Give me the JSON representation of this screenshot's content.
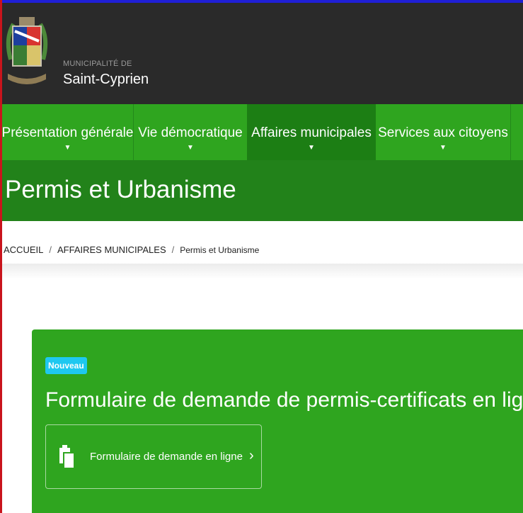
{
  "header": {
    "brand_sub": "MUNICIPALITÉ DE",
    "brand_name": "Saint-Cyprien"
  },
  "nav": {
    "items": [
      {
        "label": "Présentation générale",
        "caret": "▼"
      },
      {
        "label": "Vie démocratique",
        "caret": "▼"
      },
      {
        "label": "Affaires municipales",
        "caret": "▼"
      },
      {
        "label": "Services aux citoyens",
        "caret": "▼"
      }
    ]
  },
  "banner": {
    "title": "Permis et Urbanisme"
  },
  "breadcrumb": {
    "items": [
      "ACCUEIL",
      "AFFAIRES MUNICIPALES",
      "Permis et Urbanisme"
    ],
    "separator": "/"
  },
  "card": {
    "badge": "Nouveau",
    "title": "Formulaire de demande de permis-certificats en ligne",
    "link_label": "Formulaire de demande en ligne",
    "link_chevron": "›"
  },
  "colors": {
    "header_bg": "#2a2a2a",
    "nav_green": "#2fa51f",
    "nav_active": "#1c7e14",
    "banner_green": "#22821a",
    "badge_cyan": "#1ec8f0"
  },
  "icons": [
    "coat-of-arms-logo",
    "clipboard-icon",
    "chevron-right-icon",
    "caret-down-icon"
  ]
}
